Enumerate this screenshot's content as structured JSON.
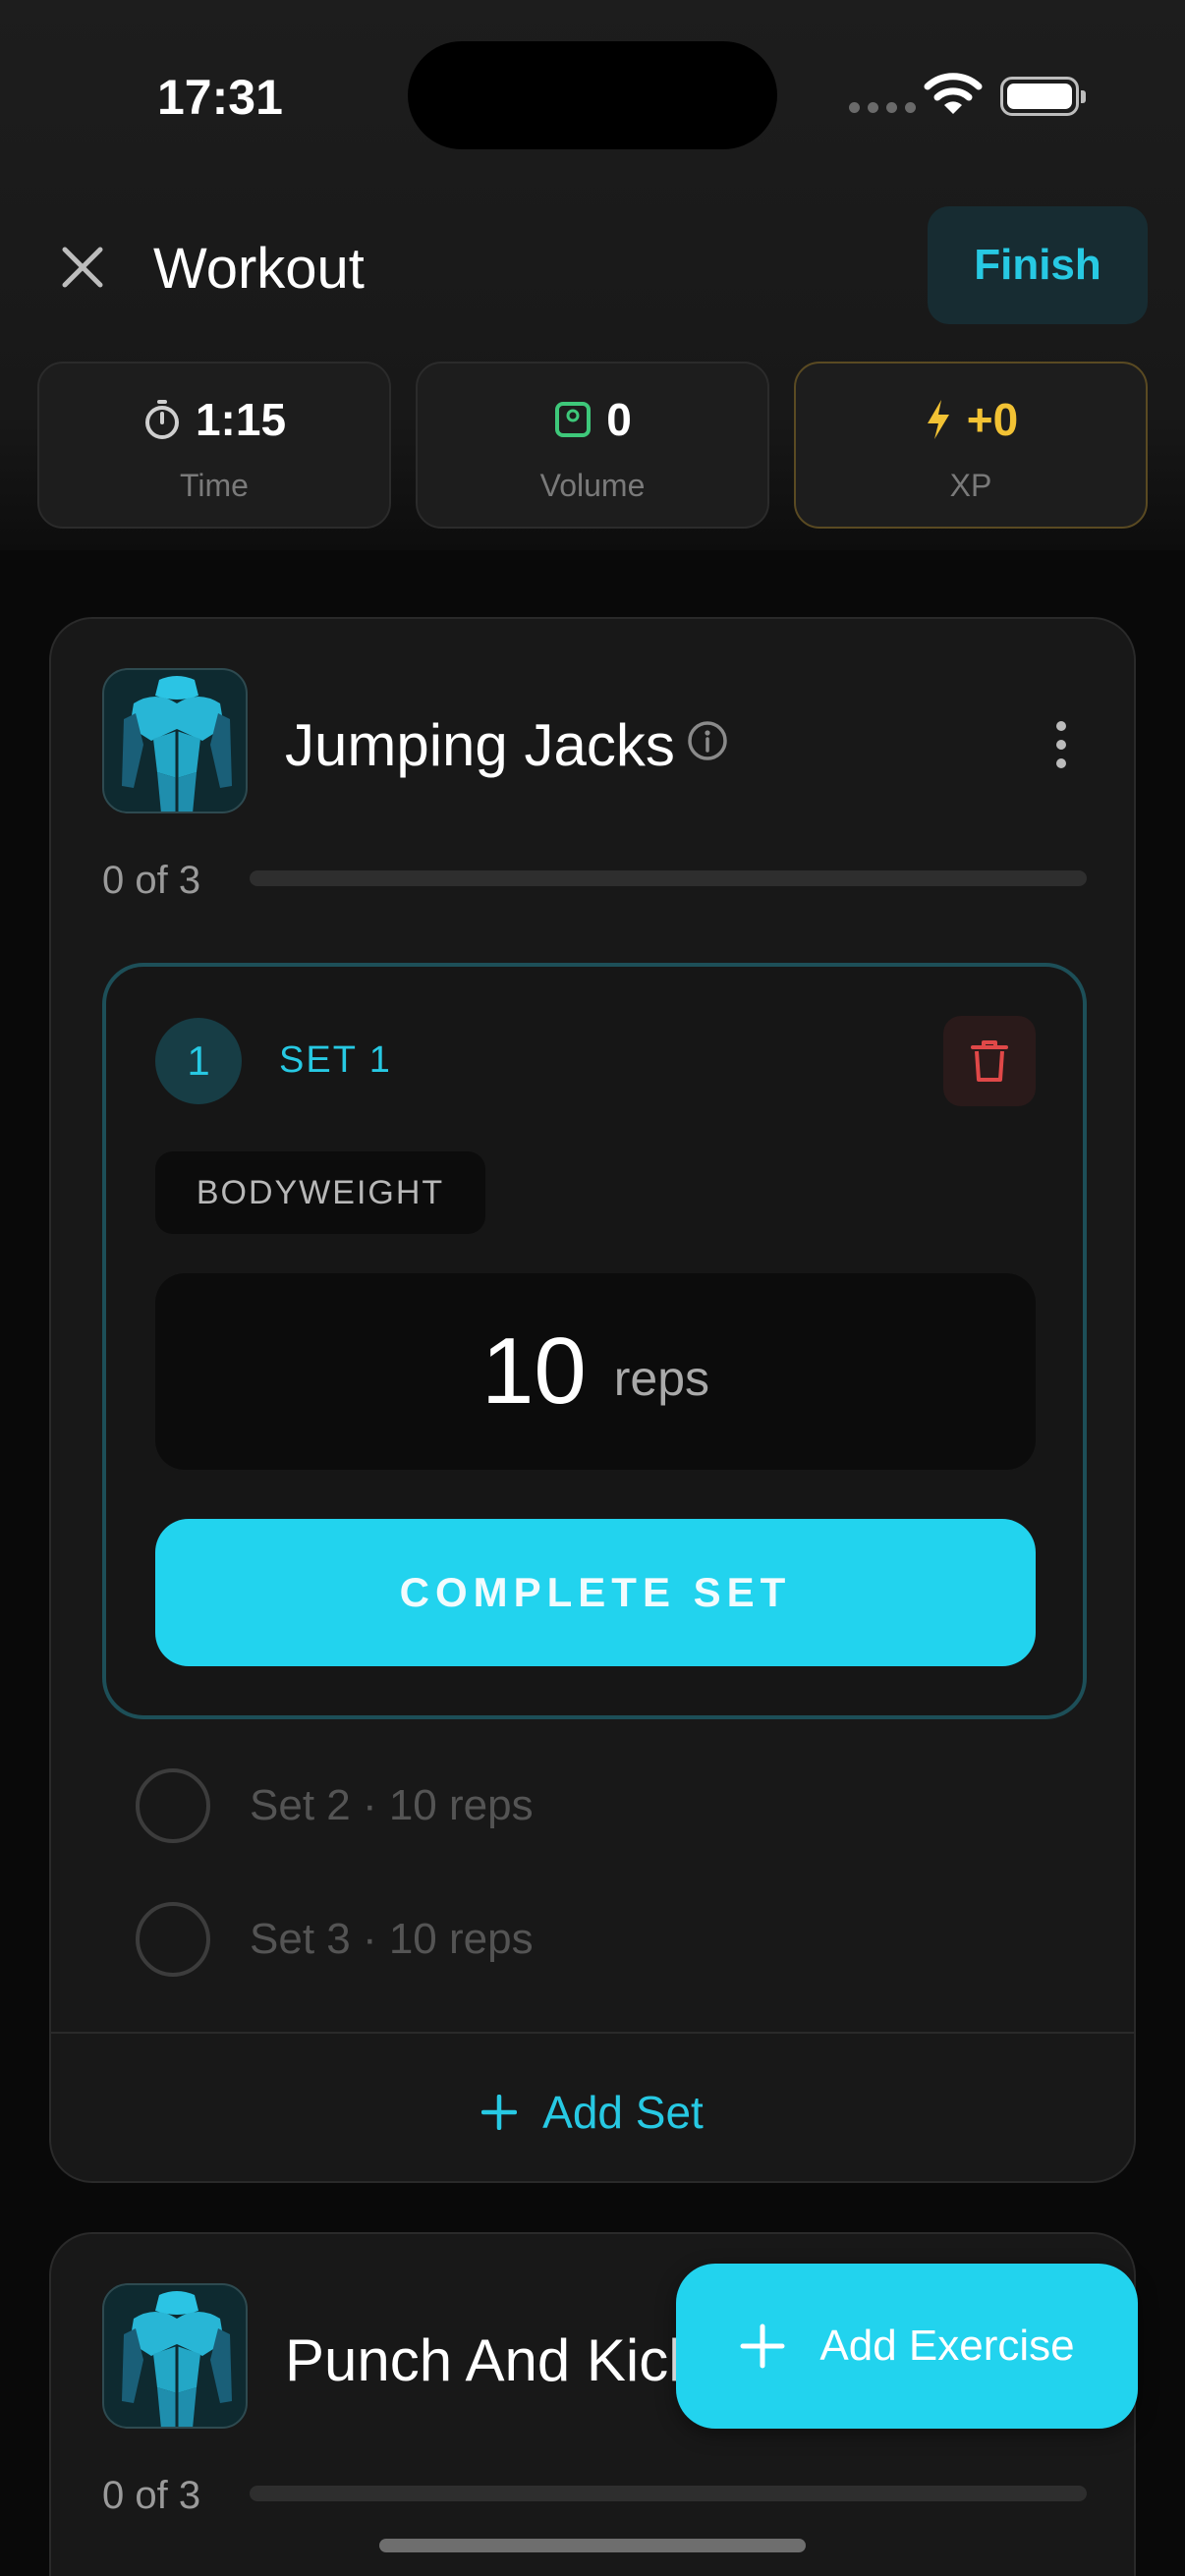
{
  "status_bar": {
    "time": "17:31"
  },
  "header": {
    "title": "Workout",
    "finish_label": "Finish"
  },
  "stats": [
    {
      "icon": "stopwatch-icon",
      "value": "1:15",
      "label": "Time",
      "color": "#cfcfcf"
    },
    {
      "icon": "scale-icon",
      "value": "0",
      "label": "Volume",
      "color": "#3ec87a"
    },
    {
      "icon": "bolt-icon",
      "value": "+0",
      "label": "XP",
      "color": "#f2c234"
    }
  ],
  "exercises": [
    {
      "name": "Jumping Jacks",
      "progress_text": "0 of 3",
      "progress": 0,
      "active_set": {
        "number": "1",
        "label": "SET 1",
        "type": "BODYWEIGHT",
        "reps_value": "10",
        "reps_unit": "reps",
        "complete_label": "COMPLETE SET"
      },
      "pending_sets": [
        {
          "label": "Set 2 · 10 reps"
        },
        {
          "label": "Set 3 · 10 reps"
        }
      ],
      "add_set_label": "Add Set"
    },
    {
      "name": "Punch And Kick",
      "progress_text": "0 of 3",
      "progress": 0
    }
  ],
  "fab": {
    "label": "Add Exercise"
  },
  "colors": {
    "accent": "#22d3ee",
    "danger": "#e04848",
    "xp": "#f2c234",
    "background": "#090909"
  }
}
